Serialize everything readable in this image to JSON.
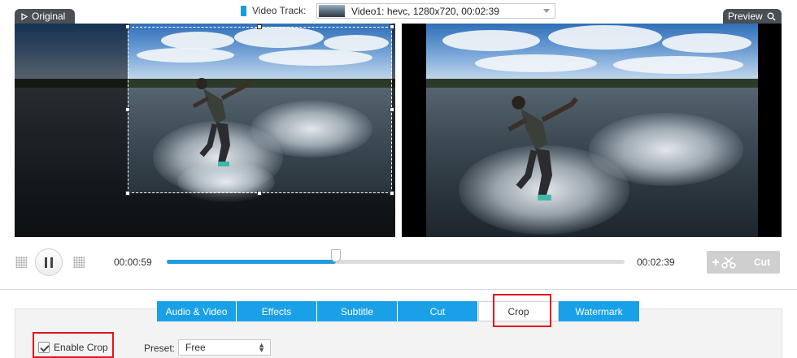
{
  "header": {
    "original_label": "Original",
    "preview_label": "Preview",
    "video_track_label": "Video Track:",
    "video_track_value": "Video1: hevc, 1280x720, 00:02:39"
  },
  "player": {
    "current_time": "00:00:59",
    "total_time": "00:02:39",
    "progress": 0.37,
    "cut_label": "Cut"
  },
  "tabs": [
    {
      "label": "Audio & Video"
    },
    {
      "label": "Effects"
    },
    {
      "label": "Subtitle"
    },
    {
      "label": "Cut"
    },
    {
      "label": "Crop"
    },
    {
      "label": "Watermark"
    }
  ],
  "active_tab": "Crop",
  "crop": {
    "enable_label": "Enable Crop",
    "enabled": true,
    "preset_label": "Preset:",
    "preset_value": "Free"
  },
  "colors": {
    "accent": "#1aa0e6",
    "highlight": "#e0161e",
    "tab_dark": "#4a4f55"
  }
}
